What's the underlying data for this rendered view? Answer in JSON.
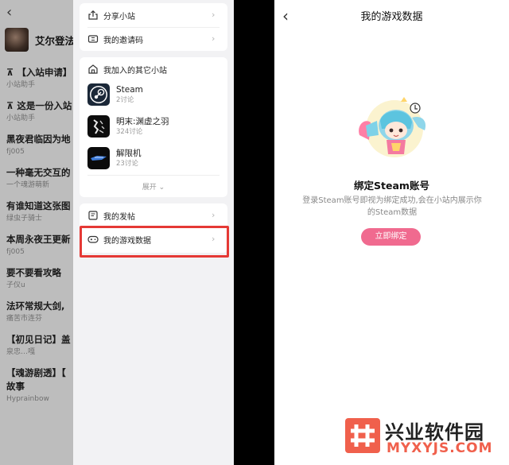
{
  "left_panel": {
    "back_glyph": "‹",
    "header_title": "艾尔登法",
    "posts": [
      {
        "title": "【入站申请】",
        "sub": "小站助手",
        "pinned": true
      },
      {
        "title": "这是一份入站",
        "sub": "小站助手",
        "pinned": true
      },
      {
        "title": "黑夜君临因为地",
        "sub": "fj005"
      },
      {
        "title": "一种毫无交互的",
        "sub": "一个魂游萌新"
      },
      {
        "title": "有谁知道这张图",
        "sub": "绿虫子骑士"
      },
      {
        "title": "本周永夜王更新",
        "sub": "fj005"
      },
      {
        "title": "要不要看攻略",
        "sub": "子仪u"
      },
      {
        "title": "法环常规大剑,",
        "sub": "痛苦市连芬"
      },
      {
        "title": "【初见日记】盖",
        "sub": "泉忠…嘎"
      },
      {
        "title": "【魂游剧透】【",
        "title2": "故事",
        "sub": "Hyprainbow"
      }
    ]
  },
  "menu": {
    "share_label": "分享小站",
    "invite_label": "我的邀请码",
    "joined_title": "我加入的其它小站",
    "communities": [
      {
        "name": "Steam",
        "count": "2讨论",
        "logo": "steam-logo"
      },
      {
        "name": "明末:渊虚之羽",
        "count": "324讨论",
        "logo": "game-logo-dark"
      },
      {
        "name": "解限机",
        "count": "23讨论",
        "logo": "game-logo-blue"
      }
    ],
    "expand_label": "展开",
    "my_posts_label": "我的发帖",
    "game_data_label": "我的游戏数据",
    "highlight_color": "#e53935"
  },
  "detail": {
    "back_glyph": "‹",
    "title": "我的游戏数据",
    "heading": "绑定Steam账号",
    "description": "登录Steam账号即视为绑定成功,会在小站内展示你的Steam数据",
    "button_label": "立即绑定",
    "accent_color": "#f06a8f"
  },
  "watermark": {
    "cn": "兴业软件园",
    "en": "MYXYJS.COM",
    "color": "#f0604c"
  }
}
